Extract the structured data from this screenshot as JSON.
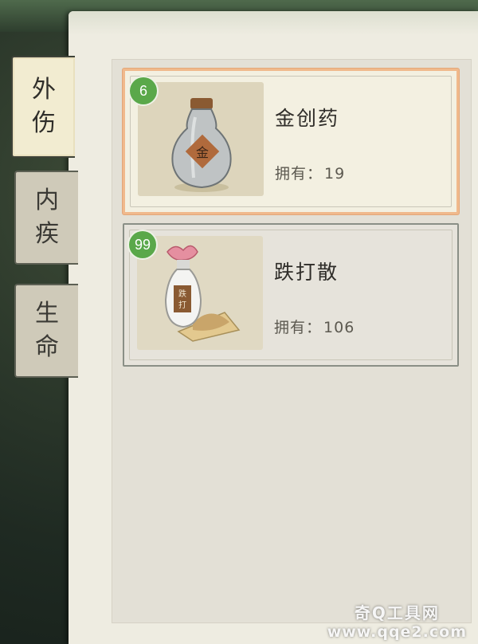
{
  "tabs": [
    {
      "label": "外伤",
      "active": true
    },
    {
      "label": "内疾",
      "active": false
    },
    {
      "label": "生命",
      "active": false
    }
  ],
  "items": [
    {
      "quantity": "6",
      "name": "金创药",
      "owned_label": "拥有：",
      "owned_value": "19",
      "icon": "gold-wound-medicine-bottle-icon",
      "selected": true
    },
    {
      "quantity": "99",
      "name": "跌打散",
      "owned_label": "拥有：",
      "owned_value": "106",
      "icon": "bruise-powder-bottle-icon",
      "selected": false
    }
  ],
  "watermark": {
    "line1": "奇Q工具网",
    "line2": "www.qqe2.com"
  },
  "colors": {
    "panel": "#eeece1",
    "selected_border": "#f0b98c",
    "badge_green": "#5aa84a",
    "tab_active": "#f2ecd1"
  }
}
